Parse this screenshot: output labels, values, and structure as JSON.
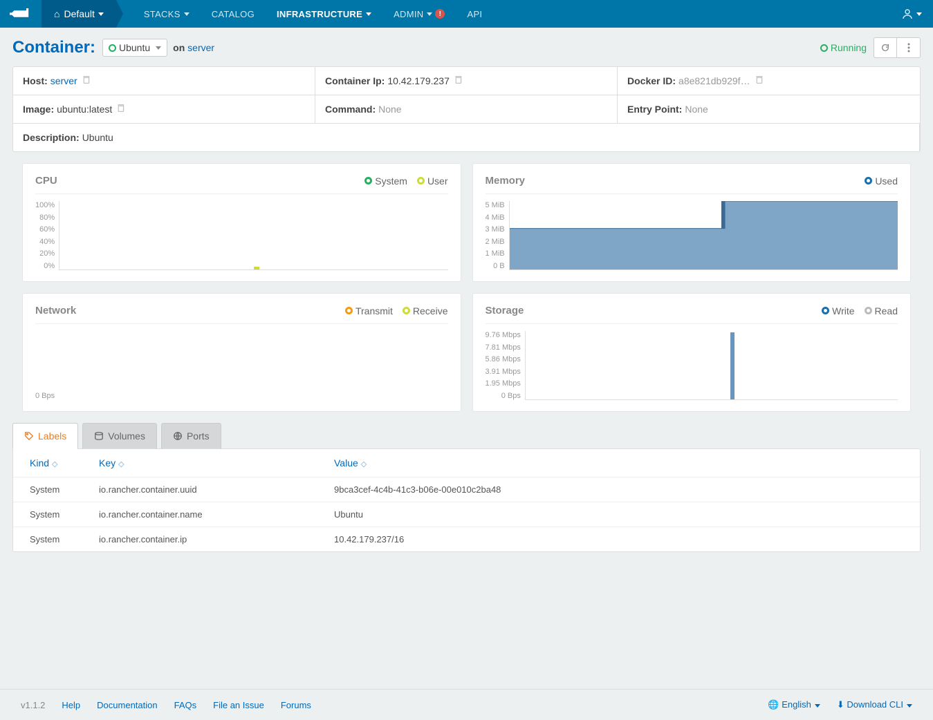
{
  "nav": {
    "env": "Default",
    "items": [
      "STACKS",
      "CATALOG",
      "INFRASTRUCTURE",
      "ADMIN",
      "API"
    ],
    "active": 2,
    "alert": "!"
  },
  "header": {
    "title": "Container:",
    "selected": "Ubuntu",
    "on": "on ",
    "server": "server",
    "status": "Running"
  },
  "info": {
    "host_label": "Host: ",
    "host_value": "server",
    "ip_label": "Container Ip: ",
    "ip_value": "10.42.179.237",
    "docker_label": "Docker ID: ",
    "docker_value": "a8e821db929f…",
    "image_label": "Image: ",
    "image_value": "ubuntu:latest",
    "command_label": "Command: ",
    "command_value": "None",
    "entry_label": "Entry Point: ",
    "entry_value": "None",
    "desc_label": "Description: ",
    "desc_value": "Ubuntu"
  },
  "charts": {
    "cpu": {
      "title": "CPU",
      "legend": [
        "System",
        "User"
      ],
      "yaxis": [
        "100%",
        "80%",
        "60%",
        "40%",
        "20%",
        "0%"
      ]
    },
    "memory": {
      "title": "Memory",
      "legend": [
        "Used"
      ],
      "yaxis": [
        "5 MiB",
        "4 MiB",
        "3 MiB",
        "2 MiB",
        "1 MiB",
        "0 B"
      ]
    },
    "network": {
      "title": "Network",
      "legend": [
        "Transmit",
        "Receive"
      ],
      "yaxis": [
        "0 Bps"
      ]
    },
    "storage": {
      "title": "Storage",
      "legend": [
        "Write",
        "Read"
      ],
      "yaxis": [
        "9.76 Mbps",
        "7.81 Mbps",
        "5.86 Mbps",
        "3.91 Mbps",
        "1.95 Mbps",
        "0 Bps"
      ]
    }
  },
  "tabs": {
    "items": [
      "Labels",
      "Volumes",
      "Ports"
    ],
    "active": 0
  },
  "table": {
    "headers": [
      "Kind",
      "Key",
      "Value"
    ],
    "rows": [
      [
        "System",
        "io.rancher.container.uuid",
        "9bca3cef-4c4b-41c3-b06e-00e010c2ba48"
      ],
      [
        "System",
        "io.rancher.container.name",
        "Ubuntu"
      ],
      [
        "System",
        "io.rancher.container.ip",
        "10.42.179.237/16"
      ]
    ]
  },
  "footer": {
    "version": "v1.1.2",
    "links": [
      "Help",
      "Documentation",
      "FAQs",
      "File an Issue",
      "Forums"
    ],
    "lang": "English",
    "download": "Download CLI"
  },
  "chart_data": [
    {
      "type": "line",
      "title": "CPU",
      "series": [
        {
          "name": "System",
          "values": [
            0,
            0,
            0,
            0,
            0,
            0
          ]
        },
        {
          "name": "User",
          "values": [
            0,
            0,
            0,
            0,
            0,
            0
          ]
        }
      ],
      "ylabel": "%",
      "ylim": [
        0,
        100
      ]
    },
    {
      "type": "area",
      "title": "Memory",
      "series": [
        {
          "name": "Used",
          "values": [
            3,
            3,
            3,
            3,
            5,
            5
          ]
        }
      ],
      "ylabel": "MiB",
      "ylim": [
        0,
        5
      ]
    },
    {
      "type": "line",
      "title": "Network",
      "series": [
        {
          "name": "Transmit",
          "values": [
            0
          ]
        },
        {
          "name": "Receive",
          "values": [
            0
          ]
        }
      ],
      "ylabel": "Bps",
      "ylim": [
        0,
        0
      ]
    },
    {
      "type": "bar",
      "title": "Storage",
      "series": [
        {
          "name": "Write",
          "values": [
            0,
            0,
            0,
            9.76,
            0,
            0
          ]
        },
        {
          "name": "Read",
          "values": [
            0,
            0,
            0,
            0,
            0,
            0
          ]
        }
      ],
      "ylabel": "Mbps",
      "ylim": [
        0,
        9.76
      ]
    }
  ]
}
